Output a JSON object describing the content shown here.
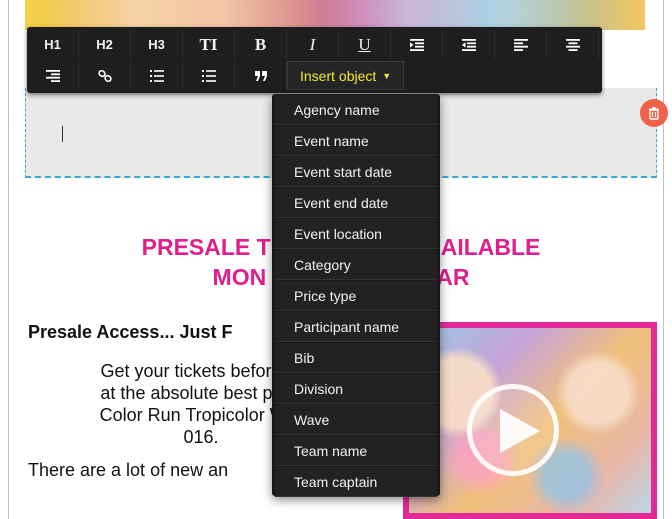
{
  "toolbar": {
    "row1": [
      {
        "label": "H1",
        "name": "heading1-button"
      },
      {
        "label": "H2",
        "name": "heading2-button"
      },
      {
        "label": "H3",
        "name": "heading3-button"
      },
      {
        "label": "TI",
        "name": "text-size-button"
      },
      {
        "label": "B",
        "name": "bold-button"
      },
      {
        "label": "I",
        "name": "italic-button"
      },
      {
        "label": "U",
        "name": "underline-button"
      }
    ],
    "insert_object_label": "Insert object",
    "icons": {
      "indent": "indent-icon",
      "outdent": "outdent-icon",
      "align_left": "align-left-icon",
      "align_center": "align-center-icon",
      "align_right": "align-right-icon",
      "link": "link-icon",
      "ordered_list": "ordered-list-icon",
      "unordered_list": "unordered-list-icon",
      "quote": "quote-icon"
    }
  },
  "insert_menu": {
    "items": [
      "Agency name",
      "Event name",
      "Event start date",
      "Event end date",
      "Event location",
      "Category",
      "Price type",
      "Participant name",
      "Bib",
      "Division",
      "Wave",
      "Team name",
      "Team captain"
    ]
  },
  "content": {
    "headline_line1": "PRESALE T",
    "headline_line1_end": "AILABLE",
    "headline_line2": "MON",
    "headline_line2_end": "AR",
    "body_heading": "Presale Access... Just F",
    "body_para_lines": [
      "Get your tickets before th",
      "at the absolute best price",
      "Color Run Tropicolor Wor",
      "016."
    ],
    "body_para2": "There are a lot of new an"
  },
  "colors": {
    "accent_pink": "#e01f8f",
    "insert_yellow": "#f2ea2e",
    "delete_red": "#f0614a",
    "dashed_blue": "#39a7d6"
  }
}
